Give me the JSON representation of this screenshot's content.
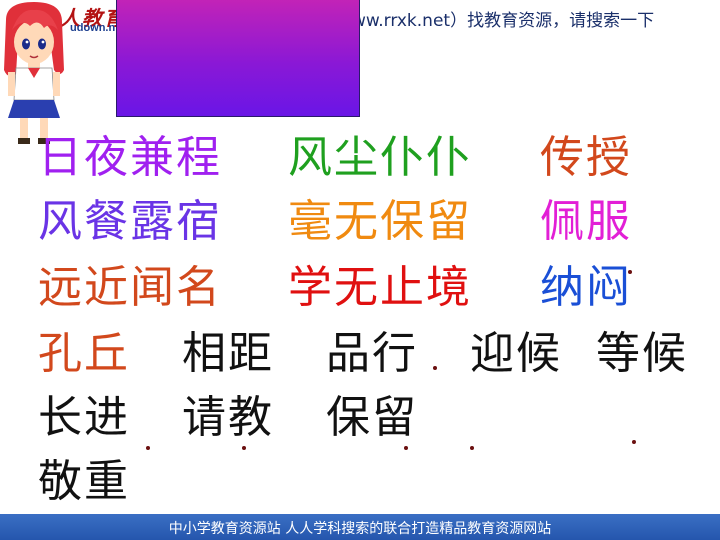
{
  "header": {
    "logo_text": "人人教育",
    "logo_sub": "udown.n",
    "banner": "ww.rrxk.net）找教育资源，请搜索一下"
  },
  "colors": {
    "purple": "#a020f0",
    "green": "#1fa01f",
    "orange_red": "#d2481c",
    "blue_violet": "#6a34e6",
    "orange": "#f08a10",
    "magenta": "#e21fd6",
    "red": "#e01010",
    "blue": "#1a4fd6",
    "black": "#111111",
    "footer": "#2e62b8"
  },
  "rows": [
    {
      "words": [
        "日夜兼程",
        "风尘仆仆",
        "传授"
      ]
    },
    {
      "words": [
        "风餐露宿",
        "毫无保留",
        "佩服"
      ]
    },
    {
      "words": [
        "远近闻名",
        "学无止境",
        "纳闷"
      ]
    },
    {
      "words": [
        "孔丘",
        "相距",
        "品行",
        "迎候",
        "等候"
      ]
    },
    {
      "words": [
        "长进",
        "请教",
        "保留"
      ]
    },
    {
      "words": [
        "敬重"
      ]
    }
  ],
  "footer": {
    "text": "中小学教育资源站 人人学科搜索的联合打造精品教育资源网站"
  }
}
